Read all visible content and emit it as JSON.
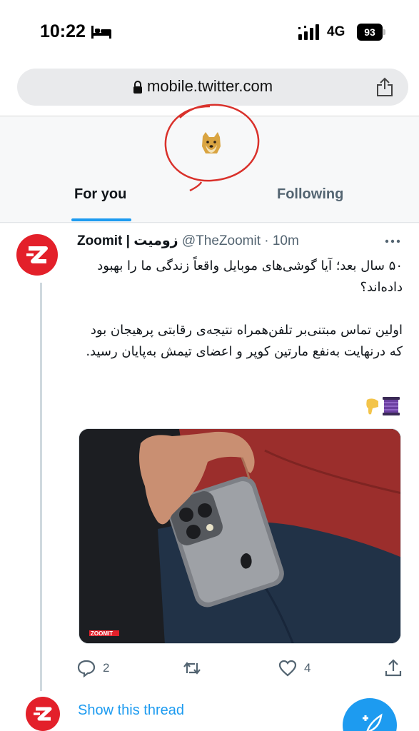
{
  "status_bar": {
    "time": "10:22",
    "network": "4G",
    "battery": "93"
  },
  "browser": {
    "url": "mobile.twitter.com"
  },
  "tabs": {
    "for_you": "For you",
    "following": "Following"
  },
  "tweet": {
    "author": "Zoomit | زومیت",
    "handle": "@TheZoomit · 10m",
    "paragraphs": [
      "۵۰ سال بعد؛ آیا گوشی‌های موبایل واقعاً زندگی ما را بهبود داده‌اند؟",
      "اولین تماس مبتنی‌بر تلفن‌همراه نتیجه‌ی رقابتی پرهیجان بود که درنهایت به‌نفع مارتین کوپر و اعضای تیمش به‌پایان رسید."
    ],
    "image_watermark": "ZOOMIT",
    "reply_count": "2",
    "like_count": "4"
  },
  "thread": {
    "show_thread": "Show this thread"
  },
  "colors": {
    "accent": "#1d9bf0",
    "brand": "#e3202a",
    "secondary_text": "#536471"
  }
}
